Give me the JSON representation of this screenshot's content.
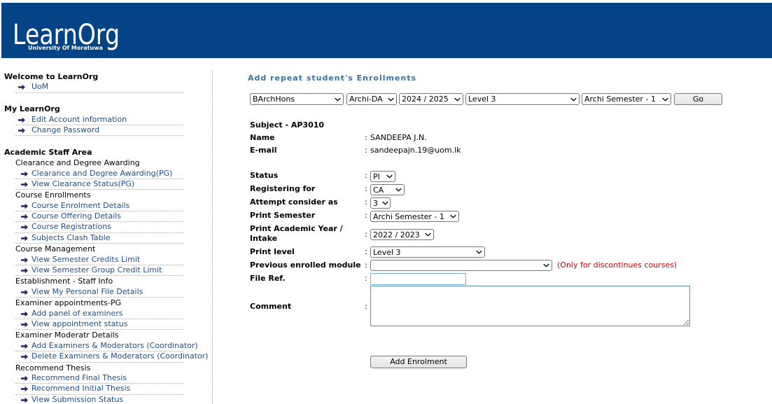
{
  "colors": {
    "header_bg": "#044386",
    "link": "#1d4e89",
    "title": "#3572a8",
    "note": "#cc0000",
    "menu_arrow": "#252565"
  },
  "icons": {
    "menu_arrow": "arrow-right-icon",
    "dropdown": "chevron-down-icon"
  },
  "header": {
    "logo_text": "LearnOrg",
    "logo_subtitle": "University Of Moratuwa"
  },
  "sidebar": {
    "welcome": {
      "title": "Welcome to LearnOrg",
      "links": [
        "UoM"
      ]
    },
    "my_learnorg": {
      "title": "My LearnOrg",
      "links": [
        "Edit Account information",
        "Change Password"
      ]
    },
    "academic": {
      "title": "Academic Staff Area",
      "groups": [
        {
          "name": "Clearance and Degree Awarding",
          "links": [
            "Clearance and Degree Awarding(PG)",
            "View Clearance Status(PG)"
          ]
        },
        {
          "name": "Course Enrollments",
          "links": [
            "Course Enrolment Details",
            "Course Offering Details",
            "Course Registrations",
            "Subjects Clash Table"
          ]
        },
        {
          "name": "Course Management",
          "links": [
            "View Semester Credits Limit",
            "View Semester Group Credit Limit"
          ]
        },
        {
          "name": "Establishment - Staff Info",
          "links": [
            "View My Personal File Details"
          ]
        },
        {
          "name": "Examiner appointments-PG",
          "links": [
            "Add panel of examiners",
            "View appointment status"
          ]
        },
        {
          "name": "Examiner Moderatr Details",
          "links": [
            "Add Examiners & Moderators (Coordinator)",
            "Delete Examiners & Moderators (Coordinator)"
          ]
        },
        {
          "name": "Recommend Thesis",
          "links": [
            "Recommend Final Thesis",
            "Recommend Initial Thesis",
            "View Submission Status"
          ]
        }
      ]
    }
  },
  "main": {
    "title": "Add repeat student's Enrollments",
    "filters": {
      "degree": "BArchHons",
      "course": "Archi-DA",
      "academic_year": "2024 / 2025",
      "level": "Level 3",
      "semester": "Archi Semester - 1",
      "go_label": "Go"
    },
    "form": {
      "separator": ":",
      "subject": "Subject - AP3010",
      "name_label": "Name",
      "name_value": "SANDEEPA J.N.",
      "email_label": "E-mail",
      "email_value": "sandeepajn.19@uom.lk",
      "status_label": "Status",
      "status_value": "PI",
      "registering_label": "Registering for",
      "registering_value": "CA",
      "attempt_label": "Attempt consider as",
      "attempt_value": "3",
      "print_semester_label": "Print Semester",
      "print_semester_value": "Archi Semester - 1",
      "print_year_label": "Print Academic Year / Intake",
      "print_year_value": "2022 / 2023",
      "print_level_label": "Print level",
      "print_level_value": "Level 3",
      "previous_module_label": "Previous enrolled module",
      "previous_module_value": "",
      "previous_module_note": "(Only for discontinues courses)",
      "file_ref_label": "File Ref.",
      "file_ref_value": "",
      "comment_label": "Comment",
      "comment_value": "",
      "submit_label": "Add Enrolment"
    }
  }
}
